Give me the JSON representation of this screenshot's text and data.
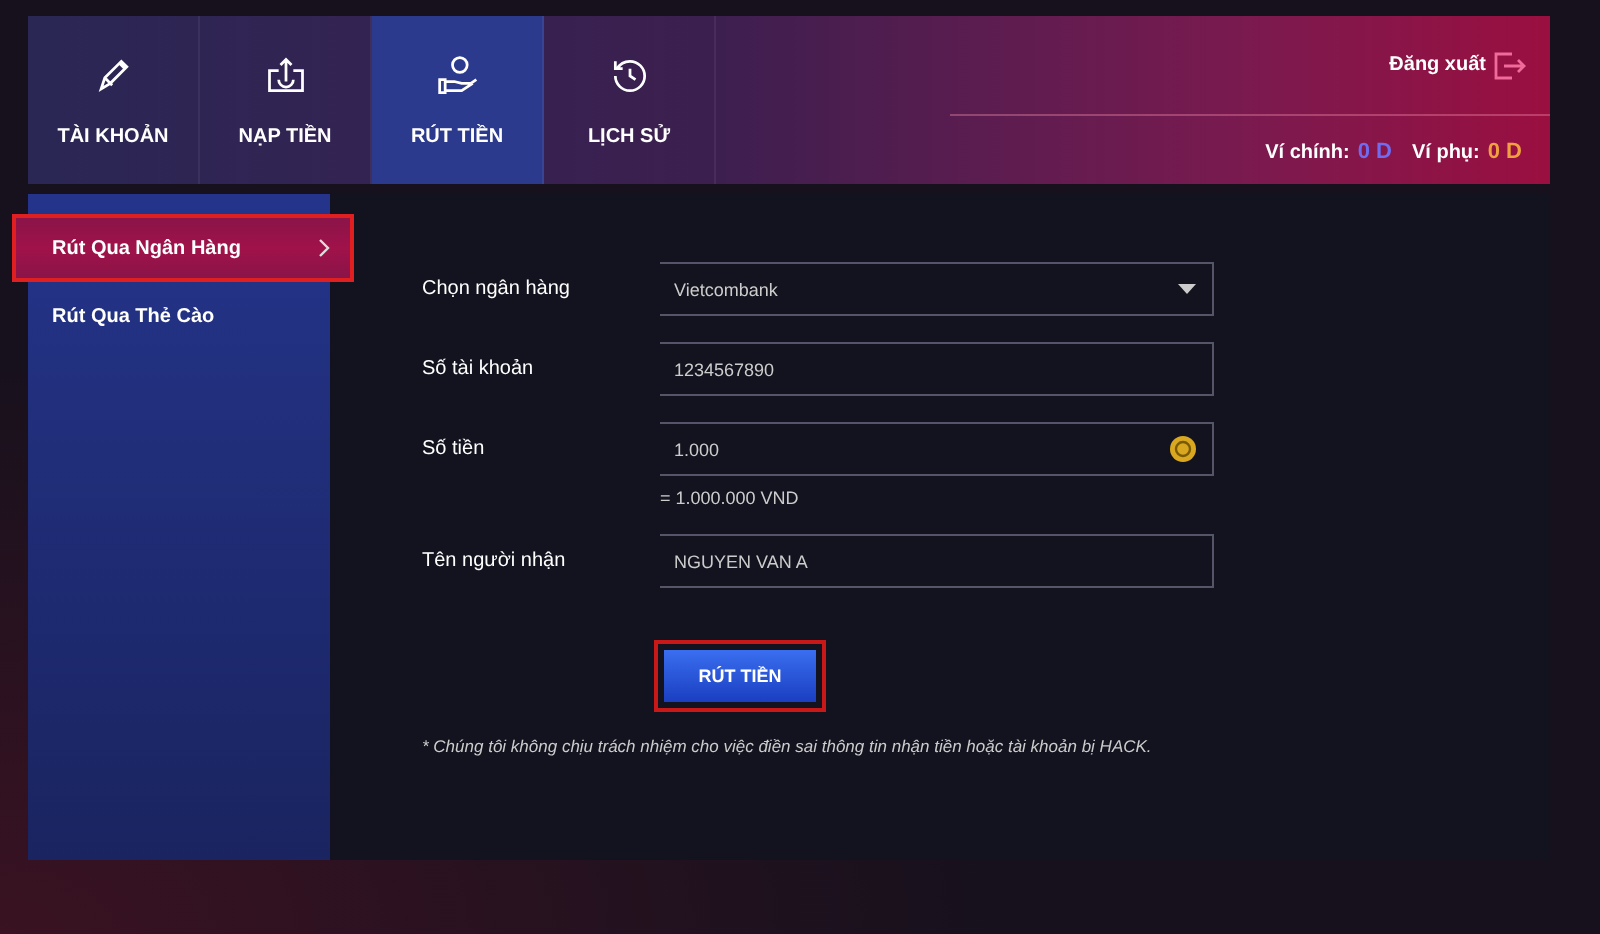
{
  "tabs": [
    {
      "label": "TÀI KHOẢN",
      "kind": "pencil",
      "selected": false
    },
    {
      "label": "NẠP TIỀN",
      "kind": "deposit",
      "selected": false
    },
    {
      "label": "RÚT TIỀN",
      "kind": "withdraw",
      "selected": true
    },
    {
      "label": "LỊCH SỬ",
      "kind": "history",
      "selected": false
    }
  ],
  "logout": "Đăng xuất",
  "wallets": [
    {
      "label": "Ví chính:",
      "value": "0 D",
      "color": "#6f6cf0"
    },
    {
      "label": "Ví phụ:",
      "value": "0 D",
      "color": "#f0a040"
    }
  ],
  "sidebar": {
    "items": [
      {
        "label": "Rút Qua Ngân Hàng",
        "selected": true,
        "annotated": true
      },
      {
        "label": "Rút Qua Thẻ Cào",
        "selected": false,
        "annotated": false
      }
    ]
  },
  "form": {
    "fields": [
      {
        "label": "Chọn ngân hàng",
        "kind": "select",
        "value": "Vietcombank"
      },
      {
        "label": "Số tài khoản",
        "kind": "text",
        "value": "1234567890"
      },
      {
        "label": "Số tiền",
        "kind": "coin",
        "value": "1.000",
        "note": "= 1.000.000 VND"
      },
      {
        "label": "Tên người nhận",
        "kind": "text",
        "value": "NGUYEN VAN A"
      }
    ],
    "submit": {
      "label": "RÚT TIỀN",
      "annotated": true
    },
    "disclaimer": "* Chúng tôi không chịu trách nhiệm cho việc điền sai thông tin nhận tiền hoặc tài khoản bị HACK."
  }
}
